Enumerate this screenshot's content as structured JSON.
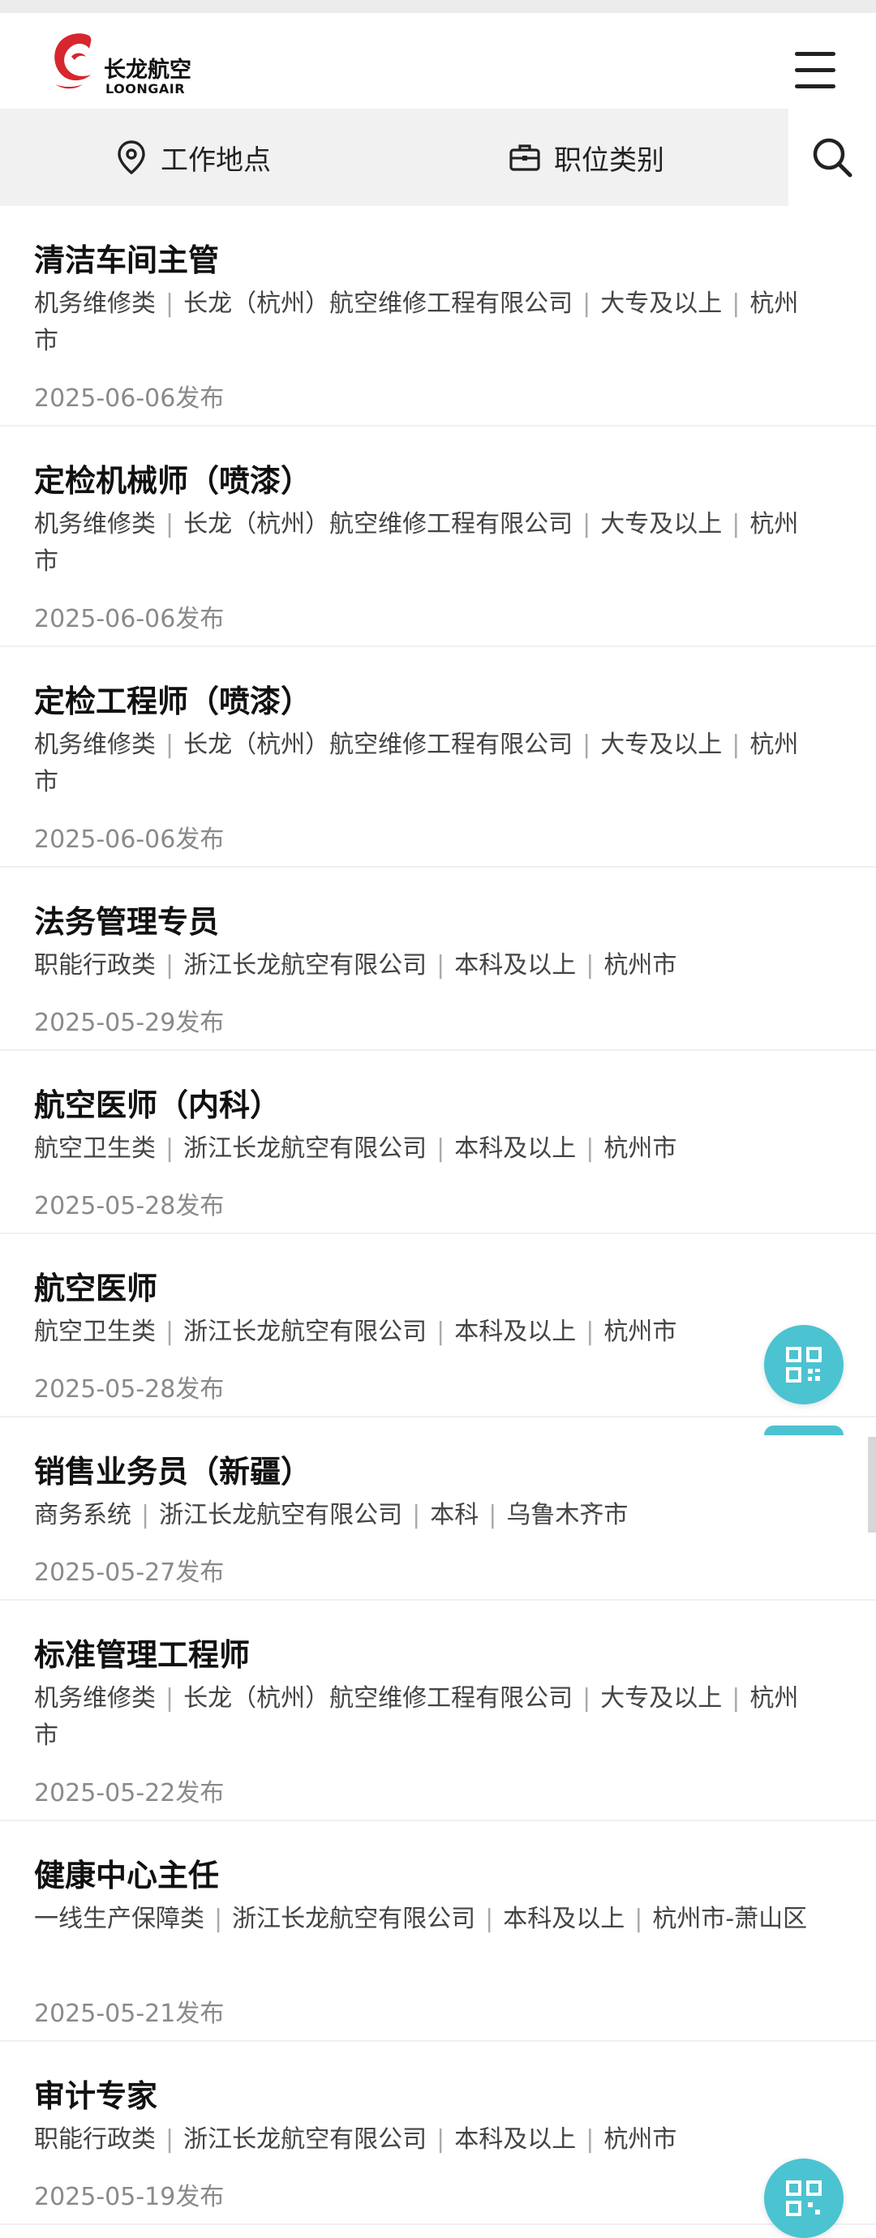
{
  "brand": {
    "name_cn": "长龙航空",
    "name_en": "LOONGAIR",
    "accent": "#d7262e"
  },
  "filters": {
    "location_label": "工作地点",
    "category_label": "职位类别"
  },
  "jobs": [
    {
      "title": "清洁车间主管",
      "category": "机务维修类",
      "company": "长龙（杭州）航空维修工程有限公司",
      "education": "大专及以上",
      "location": "杭州市",
      "date": "2025-06-06发布"
    },
    {
      "title": "定检机械师（喷漆）",
      "category": "机务维修类",
      "company": "长龙（杭州）航空维修工程有限公司",
      "education": "大专及以上",
      "location": "杭州市",
      "date": "2025-06-06发布"
    },
    {
      "title": "定检工程师（喷漆）",
      "category": "机务维修类",
      "company": "长龙（杭州）航空维修工程有限公司",
      "education": "大专及以上",
      "location": "杭州市",
      "date": "2025-06-06发布"
    },
    {
      "title": "法务管理专员",
      "category": "职能行政类",
      "company": "浙江长龙航空有限公司",
      "education": "本科及以上",
      "location": "杭州市",
      "date": "2025-05-29发布"
    },
    {
      "title": "航空医师（内科）",
      "category": "航空卫生类",
      "company": "浙江长龙航空有限公司",
      "education": "本科及以上",
      "location": "杭州市",
      "date": "2025-05-28发布"
    },
    {
      "title": "航空医师",
      "category": "航空卫生类",
      "company": "浙江长龙航空有限公司",
      "education": "本科及以上",
      "location": "杭州市",
      "date": "2025-05-28发布"
    },
    {
      "title": "销售业务员（新疆）",
      "category": "商务系统",
      "company": "浙江长龙航空有限公司",
      "education": "本科",
      "location": "乌鲁木齐市",
      "date": "2025-05-27发布"
    },
    {
      "title": "标准管理工程师",
      "category": "机务维修类",
      "company": "长龙（杭州）航空维修工程有限公司",
      "education": "大专及以上",
      "location": "杭州市",
      "date": "2025-05-22发布"
    },
    {
      "title": "健康中心主任",
      "category": "一线生产保障类",
      "company": "浙江长龙航空有限公司",
      "education": "本科及以上",
      "location": "杭州市-萧山区",
      "date": "2025-05-21发布"
    },
    {
      "title": "审计专家",
      "category": "职能行政类",
      "company": "浙江长龙航空有限公司",
      "education": "本科及以上",
      "location": "杭州市",
      "date": "2025-05-19发布"
    }
  ],
  "floating": {
    "color": "#4cc3d1",
    "icon": "qr-code-icon"
  }
}
